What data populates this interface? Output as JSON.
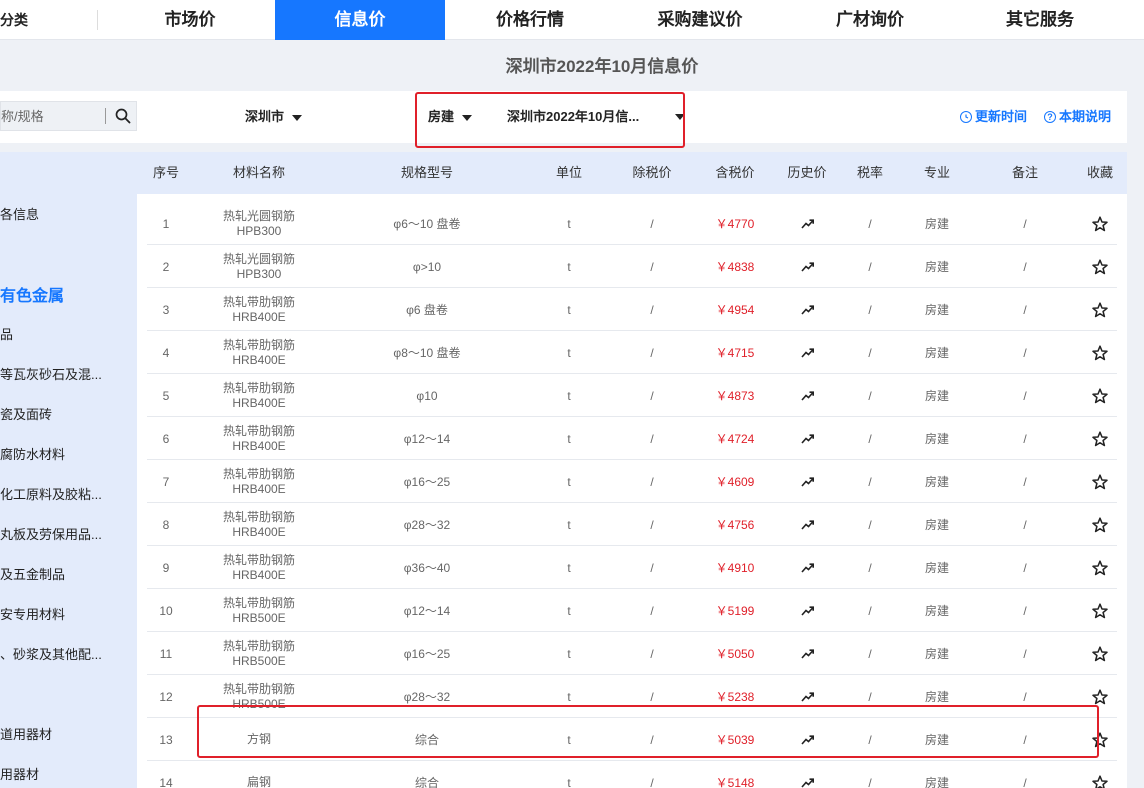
{
  "nav": {
    "category": "分类",
    "items": [
      {
        "label": "市场价"
      },
      {
        "label": "信息价"
      },
      {
        "label": "价格行情"
      },
      {
        "label": "采购建议价"
      },
      {
        "label": "广材询价"
      },
      {
        "label": "其它服务"
      }
    ]
  },
  "page_title": "深圳市2022年10月信息价",
  "filters": {
    "search_placeholder": "称/规格",
    "city": "深圳市",
    "type": "房建",
    "period": "深圳市2022年10月信...",
    "update_time": "更新时间",
    "explanation": "本期说明"
  },
  "sidebar": {
    "items": [
      "各信息",
      "有色金属",
      "品",
      "等瓦灰砂石及混...",
      "瓷及面砖",
      "腐防水材料",
      "化工原料及胶粘...",
      "丸板及劳保用品...",
      "及五金制品",
      "安专用材料",
      "、砂浆及其他配...",
      "道用器材",
      "用器材"
    ]
  },
  "table": {
    "headers": [
      "序号",
      "材料名称",
      "规格型号",
      "单位",
      "除税价",
      "含税价",
      "历史价",
      "税率",
      "专业",
      "备注",
      "收藏"
    ],
    "rows": [
      {
        "no": "1",
        "name1": "热轧光圆钢筋",
        "name2": "HPB300",
        "spec": "φ6～10 盘卷",
        "unit": "t",
        "ex_tax": "/",
        "price": "￥4770",
        "rate": "/",
        "major": "房建",
        "note": "/"
      },
      {
        "no": "2",
        "name1": "热轧光圆钢筋",
        "name2": "HPB300",
        "spec": "φ>10",
        "unit": "t",
        "ex_tax": "/",
        "price": "￥4838",
        "rate": "/",
        "major": "房建",
        "note": "/"
      },
      {
        "no": "3",
        "name1": "热轧带肋钢筋",
        "name2": "HRB400E",
        "spec": "φ6 盘卷",
        "unit": "t",
        "ex_tax": "/",
        "price": "￥4954",
        "rate": "/",
        "major": "房建",
        "note": "/"
      },
      {
        "no": "4",
        "name1": "热轧带肋钢筋",
        "name2": "HRB400E",
        "spec": "φ8～10 盘卷",
        "unit": "t",
        "ex_tax": "/",
        "price": "￥4715",
        "rate": "/",
        "major": "房建",
        "note": "/"
      },
      {
        "no": "5",
        "name1": "热轧带肋钢筋",
        "name2": "HRB400E",
        "spec": "φ10",
        "unit": "t",
        "ex_tax": "/",
        "price": "￥4873",
        "rate": "/",
        "major": "房建",
        "note": "/"
      },
      {
        "no": "6",
        "name1": "热轧带肋钢筋",
        "name2": "HRB400E",
        "spec": "φ12～14",
        "unit": "t",
        "ex_tax": "/",
        "price": "￥4724",
        "rate": "/",
        "major": "房建",
        "note": "/"
      },
      {
        "no": "7",
        "name1": "热轧带肋钢筋",
        "name2": "HRB400E",
        "spec": "φ16～25",
        "unit": "t",
        "ex_tax": "/",
        "price": "￥4609",
        "rate": "/",
        "major": "房建",
        "note": "/"
      },
      {
        "no": "8",
        "name1": "热轧带肋钢筋",
        "name2": "HRB400E",
        "spec": "φ28～32",
        "unit": "t",
        "ex_tax": "/",
        "price": "￥4756",
        "rate": "/",
        "major": "房建",
        "note": "/"
      },
      {
        "no": "9",
        "name1": "热轧带肋钢筋",
        "name2": "HRB400E",
        "spec": "φ36～40",
        "unit": "t",
        "ex_tax": "/",
        "price": "￥4910",
        "rate": "/",
        "major": "房建",
        "note": "/"
      },
      {
        "no": "10",
        "name1": "热轧带肋钢筋",
        "name2": "HRB500E",
        "spec": "φ12～14",
        "unit": "t",
        "ex_tax": "/",
        "price": "￥5199",
        "rate": "/",
        "major": "房建",
        "note": "/"
      },
      {
        "no": "11",
        "name1": "热轧带肋钢筋",
        "name2": "HRB500E",
        "spec": "φ16～25",
        "unit": "t",
        "ex_tax": "/",
        "price": "￥5050",
        "rate": "/",
        "major": "房建",
        "note": "/"
      },
      {
        "no": "12",
        "name1": "热轧带肋钢筋",
        "name2": "HRB500E",
        "spec": "φ28～32",
        "unit": "t",
        "ex_tax": "/",
        "price": "￥5238",
        "rate": "/",
        "major": "房建",
        "note": "/"
      },
      {
        "no": "13",
        "name1": "方钢",
        "name2": "",
        "spec": "综合",
        "unit": "t",
        "ex_tax": "/",
        "price": "￥5039",
        "rate": "/",
        "major": "房建",
        "note": "/"
      },
      {
        "no": "14",
        "name1": "扁钢",
        "name2": "",
        "spec": "综合",
        "unit": "t",
        "ex_tax": "/",
        "price": "￥5148",
        "rate": "/",
        "major": "房建",
        "note": "/"
      }
    ]
  },
  "colors": {
    "accent": "#1677ff",
    "price": "#e0202a",
    "highlight_box": "#e0202a"
  },
  "icons": {
    "search": "search-icon",
    "caret": "caret-down-icon",
    "clock": "clock-icon",
    "help": "help-icon",
    "trend": "trend-up-icon",
    "star": "star-outline-icon"
  }
}
